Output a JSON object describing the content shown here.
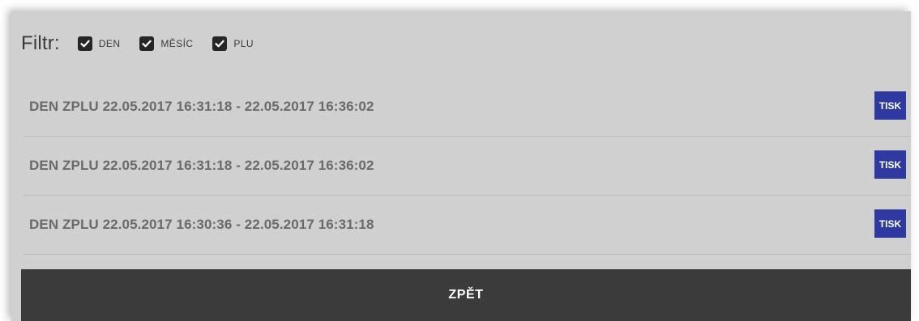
{
  "filter": {
    "label": "Filtr:",
    "options": [
      {
        "label": "DEN",
        "checked": true
      },
      {
        "label": "MĚSÍC",
        "checked": true
      },
      {
        "label": "PLU",
        "checked": true
      }
    ]
  },
  "list": {
    "rows": [
      {
        "text": "DEN ZPLU 22.05.2017 16:31:18 - 22.05.2017 16:36:02",
        "button": "TISK"
      },
      {
        "text": "DEN ZPLU 22.05.2017 16:31:18 - 22.05.2017 16:36:02",
        "button": "TISK"
      },
      {
        "text": "DEN ZPLU 22.05.2017 16:30:36 - 22.05.2017 16:31:18",
        "button": "TISK"
      }
    ]
  },
  "footer": {
    "back_label": "ZPĚT"
  },
  "colors": {
    "panel_background": "#d0d0d0",
    "print_button": "#2f3aa0",
    "back_button": "#3b3b3b",
    "checkbox": "#262626"
  }
}
